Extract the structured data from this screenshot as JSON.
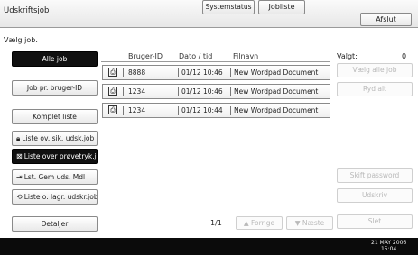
{
  "header": {
    "title": "Udskriftsjob",
    "exit_label": "Afslut"
  },
  "instruction": "Vælg job.",
  "left_buttons": {
    "all_jobs": "Alle job",
    "job_by_user": "Job pr. bruger-ID",
    "complete_list": "Komplet liste",
    "secure_list": "Liste ov. sik. udsk.job",
    "sample_list": "Liste over prøvetryk.job",
    "stored_list": "Lst. Gem uds. Mdl",
    "hold_list": "Liste o. lagr. udskr.job",
    "details": "Detaljer"
  },
  "table": {
    "columns": [
      "Bruger-ID",
      "Dato / tid",
      "Filnavn"
    ],
    "rows": [
      {
        "user": "8888",
        "datetime": "01/12 10:46",
        "file": "New Wordpad Document",
        "icon": "print-job-icon"
      },
      {
        "user": "1234",
        "datetime": "01/12 10:46",
        "file": "New Wordpad Document",
        "icon": "print-job-icon"
      },
      {
        "user": "1234",
        "datetime": "01/12 10:44",
        "file": "New Wordpad Document",
        "icon": "print-job-icon"
      }
    ]
  },
  "right_panel": {
    "selected_label": "Valgt:",
    "selected_count": "0",
    "select_all": "Vælg alle job",
    "clear_all": "Ryd alt",
    "change_password": "Skift password",
    "print": "Udskriv",
    "delete": "Slet"
  },
  "pager": {
    "page": "1/1",
    "prev": "Forrige",
    "next": "Næste"
  },
  "footer": {
    "system_status": "Systemstatus",
    "job_list": "Jobliste",
    "date": "21 MAY  2006",
    "time": "15:04"
  },
  "colors": {
    "active_button": "#101010",
    "disabled_text": "#b9b9b9",
    "bottom_bar": "#0b0b0b"
  }
}
